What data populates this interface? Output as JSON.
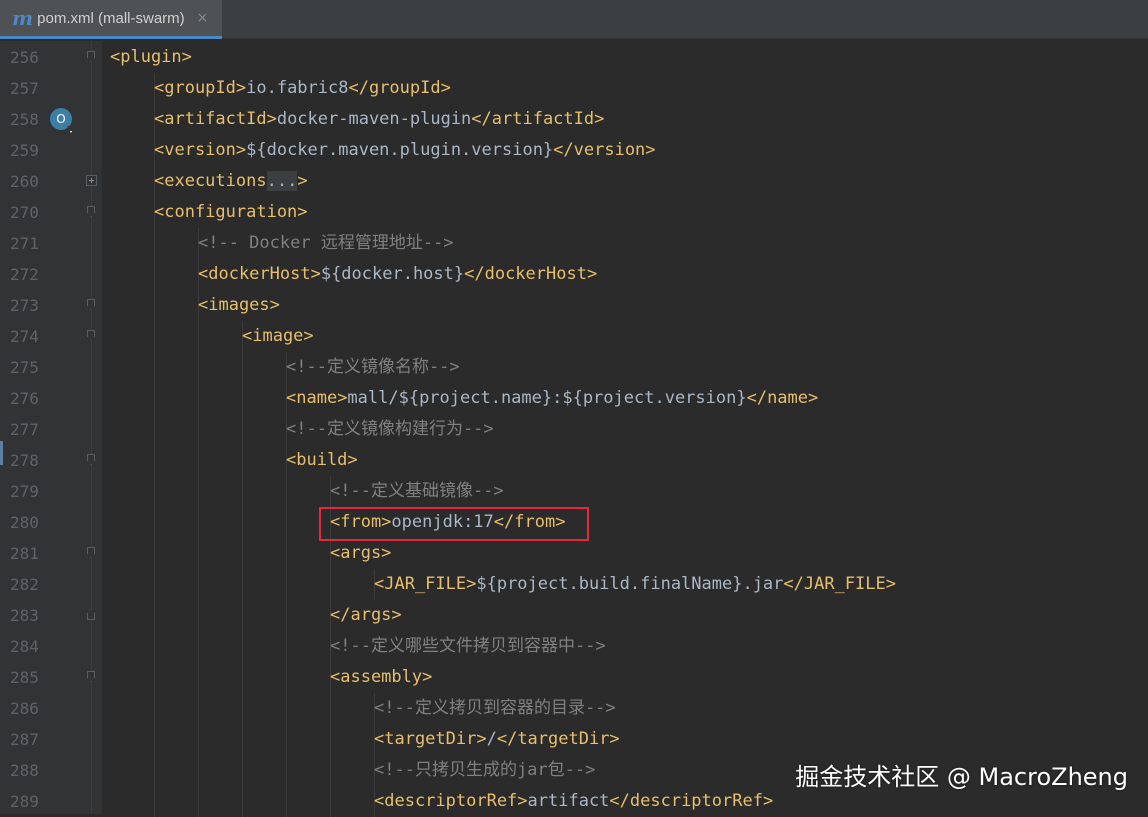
{
  "tab": {
    "icon": "maven-m-icon",
    "title": "pom.xml (mall-swarm)",
    "close_glyph": "×"
  },
  "lines": [
    {
      "num": "256",
      "indent": 0,
      "fold": "down",
      "parts": [
        {
          "t": "tag",
          "v": "<plugin>"
        }
      ]
    },
    {
      "num": "257",
      "indent": 1,
      "parts": [
        {
          "t": "tag",
          "v": "<groupId>"
        },
        {
          "t": "txt",
          "v": "io.fabric8"
        },
        {
          "t": "tag",
          "v": "</groupId>"
        }
      ]
    },
    {
      "num": "258",
      "indent": 1,
      "gutter_icon": "override-method-icon",
      "parts": [
        {
          "t": "tag",
          "v": "<artifactId>"
        },
        {
          "t": "txt",
          "v": "docker-maven-plugin"
        },
        {
          "t": "tag",
          "v": "</artifactId>"
        }
      ]
    },
    {
      "num": "259",
      "indent": 1,
      "parts": [
        {
          "t": "tag",
          "v": "<version>"
        },
        {
          "t": "txt",
          "v": "${docker.maven.plugin.version}"
        },
        {
          "t": "tag",
          "v": "</version>"
        }
      ]
    },
    {
      "num": "260",
      "indent": 1,
      "fold": "plus",
      "parts": [
        {
          "t": "tag",
          "v": "<executions"
        },
        {
          "t": "fold-ph",
          "v": "..."
        },
        {
          "t": "tag",
          "v": ">"
        }
      ]
    },
    {
      "num": "270",
      "indent": 1,
      "fold": "down",
      "parts": [
        {
          "t": "tag",
          "v": "<configuration>"
        }
      ]
    },
    {
      "num": "271",
      "indent": 2,
      "parts": [
        {
          "t": "cmt",
          "v": "<!-- Docker 远程管理地址-->"
        }
      ]
    },
    {
      "num": "272",
      "indent": 2,
      "parts": [
        {
          "t": "tag",
          "v": "<dockerHost>"
        },
        {
          "t": "txt",
          "v": "${docker.host}"
        },
        {
          "t": "tag",
          "v": "</dockerHost>"
        }
      ]
    },
    {
      "num": "273",
      "indent": 2,
      "fold": "down",
      "parts": [
        {
          "t": "tag",
          "v": "<images>"
        }
      ]
    },
    {
      "num": "274",
      "indent": 3,
      "fold": "down",
      "parts": [
        {
          "t": "tag",
          "v": "<image>"
        }
      ]
    },
    {
      "num": "275",
      "indent": 4,
      "parts": [
        {
          "t": "cmt",
          "v": "<!--定义镜像名称-->"
        }
      ]
    },
    {
      "num": "276",
      "indent": 4,
      "parts": [
        {
          "t": "tag",
          "v": "<name>"
        },
        {
          "t": "txt",
          "v": "mall/${project.name}:${project.version}"
        },
        {
          "t": "tag",
          "v": "</name>"
        }
      ]
    },
    {
      "num": "277",
      "indent": 4,
      "parts": [
        {
          "t": "cmt",
          "v": "<!--定义镜像构建行为-->"
        }
      ]
    },
    {
      "num": "278",
      "indent": 4,
      "fold": "down",
      "parts": [
        {
          "t": "tag",
          "v": "<build>"
        }
      ]
    },
    {
      "num": "279",
      "indent": 5,
      "parts": [
        {
          "t": "cmt",
          "v": "<!--定义基础镜像-->"
        }
      ]
    },
    {
      "num": "280",
      "indent": 5,
      "parts": [
        {
          "t": "tag",
          "v": "<from>"
        },
        {
          "t": "txt",
          "v": "openjdk:17"
        },
        {
          "t": "tag",
          "v": "</from>"
        }
      ]
    },
    {
      "num": "281",
      "indent": 5,
      "fold": "down",
      "parts": [
        {
          "t": "tag",
          "v": "<args>"
        }
      ]
    },
    {
      "num": "282",
      "indent": 6,
      "parts": [
        {
          "t": "tag",
          "v": "<JAR_FILE>"
        },
        {
          "t": "txt",
          "v": "${project.build.finalName}.jar"
        },
        {
          "t": "tag",
          "v": "</JAR_FILE>"
        }
      ]
    },
    {
      "num": "283",
      "indent": 5,
      "fold": "up",
      "parts": [
        {
          "t": "tag",
          "v": "</args>"
        }
      ]
    },
    {
      "num": "284",
      "indent": 5,
      "parts": [
        {
          "t": "cmt",
          "v": "<!--定义哪些文件拷贝到容器中-->"
        }
      ]
    },
    {
      "num": "285",
      "indent": 5,
      "fold": "down",
      "parts": [
        {
          "t": "tag",
          "v": "<assembly>"
        }
      ]
    },
    {
      "num": "286",
      "indent": 6,
      "parts": [
        {
          "t": "cmt",
          "v": "<!--定义拷贝到容器的目录-->"
        }
      ]
    },
    {
      "num": "287",
      "indent": 6,
      "parts": [
        {
          "t": "tag",
          "v": "<targetDir>"
        },
        {
          "t": "txt",
          "v": "/"
        },
        {
          "t": "tag",
          "v": "</targetDir>"
        }
      ]
    },
    {
      "num": "288",
      "indent": 6,
      "parts": [
        {
          "t": "cmt",
          "v": "<!--只拷贝生成的jar包-->"
        }
      ]
    },
    {
      "num": "289",
      "indent": 6,
      "parts": [
        {
          "t": "tag",
          "v": "<descriptorRef>"
        },
        {
          "t": "txt",
          "v": "artifact"
        },
        {
          "t": "tag",
          "v": "</descriptorRef>"
        }
      ]
    }
  ],
  "highlighted_line": "280",
  "colors": {
    "tag": "#e8bf6a",
    "text": "#a9b7c6",
    "comment": "#808080",
    "highlight_box": "#e5283a",
    "background": "#2b2b2b"
  },
  "watermark": "掘金技术社区 @ MacroZheng"
}
